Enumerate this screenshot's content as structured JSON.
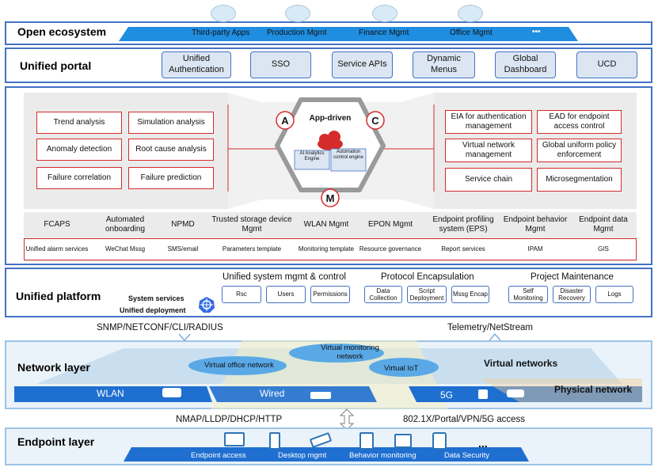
{
  "open_ecosystem": {
    "title": "Open ecosystem",
    "items": [
      "Third-party Apps",
      "Production Mgmt",
      "Finance Mgmt",
      "Office Mgmt"
    ],
    "more": "•••"
  },
  "unified_portal": {
    "title": "Unified portal",
    "items": [
      "Unified Authentication",
      "SSO",
      "Service APIs",
      "Dynamic Menus",
      "Global Dashboard",
      "UCD"
    ]
  },
  "analytics": {
    "left_boxes": [
      "Trend analysis",
      "Simulation analysis",
      "Anomaly detection",
      "Root cause analysis",
      "Failure correlation",
      "Failure prediction"
    ],
    "center_title": "App-driven",
    "center_engines": [
      "AI Analytics Engine",
      "Automation control engine"
    ],
    "letters": [
      "A",
      "C",
      "M"
    ],
    "right_boxes": [
      "EIA for authentication management",
      "EAD for endpoint access control",
      "Virtual network management",
      "Global uniform policy enforcement",
      "Service chain",
      "Microsegmentation"
    ],
    "row1": [
      "FCAPS",
      "Automated onboarding",
      "NPMD",
      "Trusted storage device Mgmt",
      "WLAN Mgmt",
      "EPON Mgmt",
      "Endpoint profiling system (EPS)",
      "Endpoint behavior Mgmt",
      "Endpoint data Mgmt"
    ],
    "row2": [
      "Unified alarm services",
      "WeChat Mssg",
      "SMS/email",
      "Parameters template",
      "Monitoring template",
      "Resource governance",
      "Report services",
      "IPAM",
      "GIS"
    ]
  },
  "unified_platform": {
    "title": "Unified platform",
    "system_services": "System services",
    "unified_deployment": "Unified deployment",
    "groups": [
      {
        "title": "Unified system mgmt & control",
        "items": [
          "Rsc",
          "Users",
          "Permissions"
        ]
      },
      {
        "title": "Protocol Encapsulation",
        "items": [
          "Data Collection",
          "Script Deployment",
          "Mssg Encap"
        ]
      },
      {
        "title": "Project Maintenance",
        "items": [
          "Self Monitoring",
          "Disaster Recovery",
          "Logs"
        ]
      }
    ]
  },
  "protocols": {
    "left": "SNMP/NETCONF/CLI/RADIUS",
    "right": "Telemetry/NetStream",
    "bottom_left": "NMAP/LLDP/DHCP/HTTP",
    "bottom_right": "802.1X/Portal/VPN/5G access"
  },
  "network_layer": {
    "title": "Network layer",
    "virtual_networks": "Virtual networks",
    "physical_network": "Physical network",
    "clouds": [
      "Virtual office network",
      "Virtual monitoring network",
      "Virtual IoT"
    ],
    "bands": [
      "WLAN",
      "Wired",
      "5G"
    ]
  },
  "endpoint_layer": {
    "title": "Endpoint layer",
    "items": [
      "Endpoint access",
      "Desktop mgmt",
      "Behavior monitoring",
      "Data Security"
    ],
    "more": "..."
  },
  "colors": {
    "border": "#4472c4",
    "accent_red": "#d42c2c",
    "band_blue": "#1f6fd0",
    "light_blue": "#dce6f2"
  }
}
